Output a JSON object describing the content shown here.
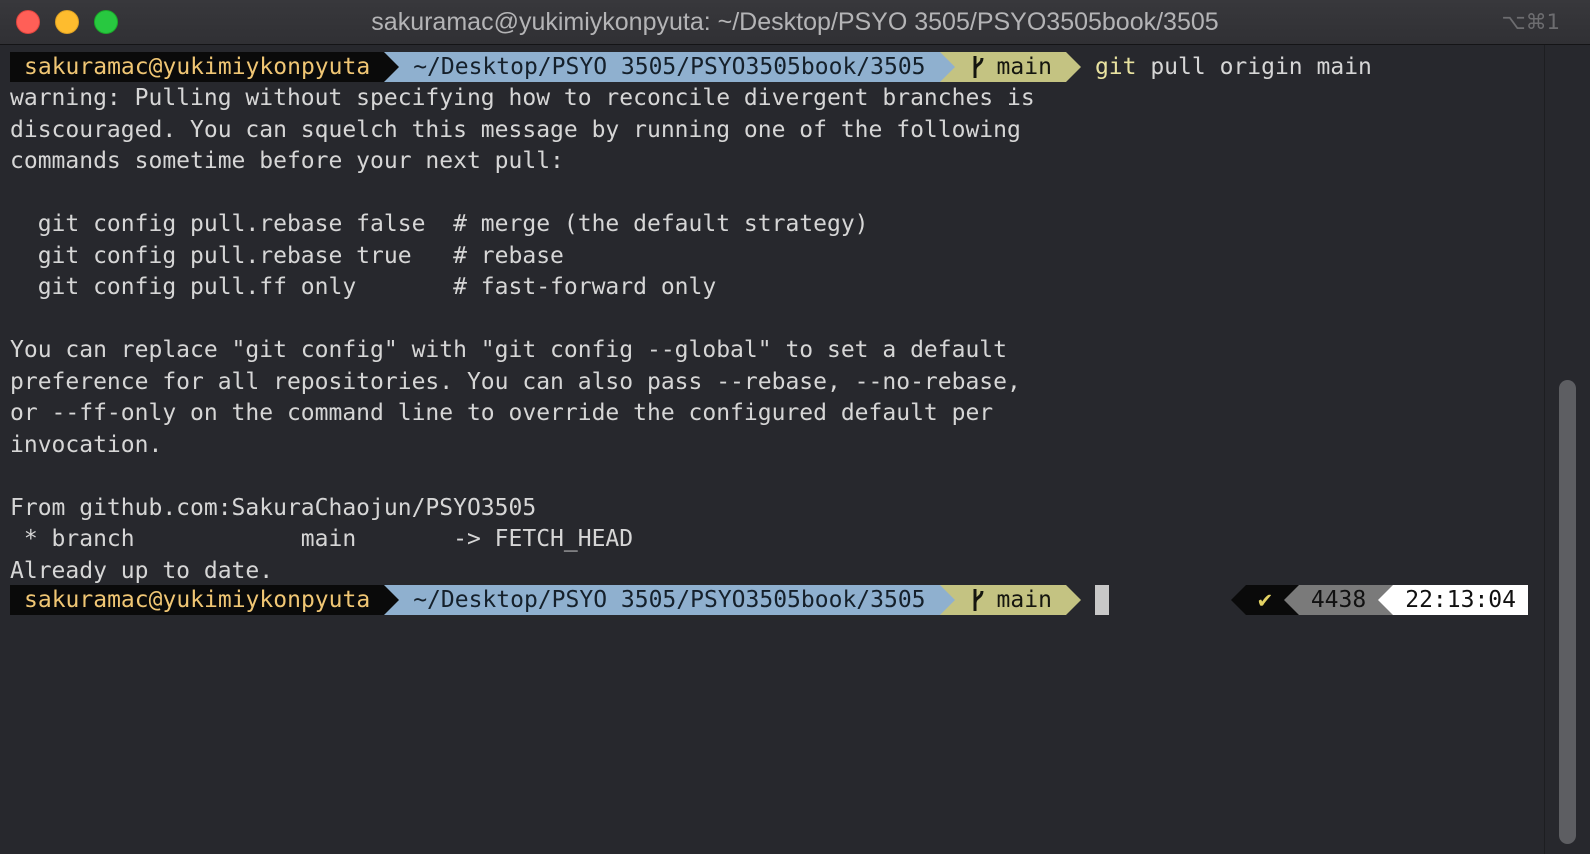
{
  "window": {
    "title": "sakuramac@yukimiykonpyuta: ~/Desktop/PSYO 3505/PSYO3505book/3505",
    "shortcut": "⌥⌘1"
  },
  "prompt": {
    "user": "sakuramac@yukimiykonpyuta",
    "dir": "~/Desktop/PSYO 3505/PSYO3505book/3505",
    "branch": "main",
    "branch_icon": "git-branch-icon"
  },
  "command": {
    "program": "git",
    "args": " pull origin main"
  },
  "output": [
    "warning: Pulling without specifying how to reconcile divergent branches is",
    "discouraged. You can squelch this message by running one of the following",
    "commands sometime before your next pull:",
    "",
    "  git config pull.rebase false  # merge (the default strategy)",
    "  git config pull.rebase true   # rebase",
    "  git config pull.ff only       # fast-forward only",
    "",
    "You can replace \"git config\" with \"git config --global\" to set a default",
    "preference for all repositories. You can also pass --rebase, --no-rebase,",
    "or --ff-only on the command line to override the configured default per",
    "invocation.",
    "",
    "From github.com:SakuraChaojun/PSYO3505",
    " * branch            main       -> FETCH_HEAD",
    "Already up to date."
  ],
  "right_prompt": {
    "status": "✔",
    "history": "4438",
    "time": "22:13:04"
  },
  "colors": {
    "background": "#27282d",
    "user_segment": "#0a0a0a",
    "user_text": "#f0c674",
    "dir_segment": "#8fb0cf",
    "git_segment": "#c4c382",
    "status_ok": "#e3d264"
  }
}
